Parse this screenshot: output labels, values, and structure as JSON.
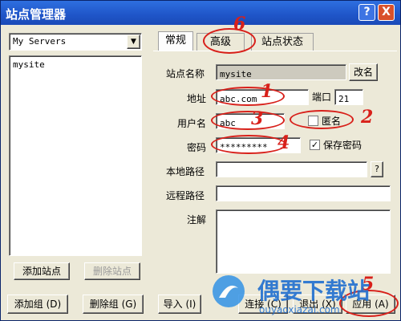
{
  "window": {
    "title": "站点管理器",
    "help_button": "?",
    "close_button": "X"
  },
  "left": {
    "server_select_value": "My Servers",
    "sites": [
      "mysite"
    ],
    "add_site": "添加站点",
    "delete_site": "删除站点"
  },
  "tabs": [
    {
      "label": "常规",
      "active": true
    },
    {
      "label": "高级",
      "active": false
    },
    {
      "label": "站点状态",
      "active": false
    }
  ],
  "form": {
    "site_name_label": "站点名称",
    "site_name_value": "mysite",
    "rename_button": "改名",
    "address_label": "地址",
    "address_value": "abc.com",
    "port_label": "端口",
    "port_value": "21",
    "username_label": "用户名",
    "username_value": "abc",
    "anonymous_label": "匿名",
    "anonymous_checked": false,
    "password_label": "密码",
    "password_value": "*********",
    "save_password_label": "保存密码",
    "save_password_checked": true,
    "local_path_label": "本地路径",
    "local_path_value": "",
    "browse_button": "?",
    "remote_path_label": "远程路径",
    "remote_path_value": "",
    "note_label": "注解",
    "note_value": ""
  },
  "bottom": {
    "add_group": "添加组 (D)",
    "delete_group": "删除组 (G)",
    "import": "导入 (I)",
    "connect": "连接 (C)",
    "exit": "退出 (X)",
    "apply": "应用 (A)"
  },
  "annotations": [
    "1",
    "2",
    "3",
    "4",
    "5",
    "6"
  ],
  "watermark": {
    "brand": "偶要下载站",
    "url": "ouyaoxiazai.com"
  },
  "colors": {
    "annotation": "#d8201a",
    "title_bar": "#1f55c8",
    "dialog_bg": "#ece9d8"
  }
}
